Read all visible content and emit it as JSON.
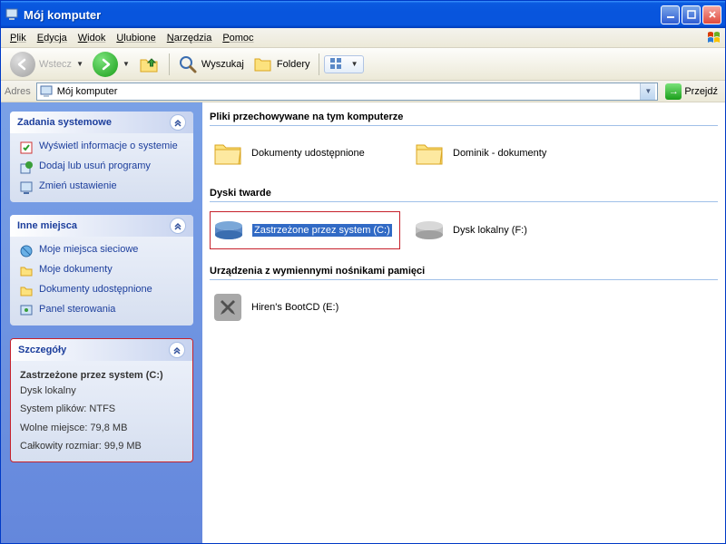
{
  "titlebar": {
    "title": "Mój komputer"
  },
  "menubar": {
    "items": [
      "Plik",
      "Edycja",
      "Widok",
      "Ulubione",
      "Narzędzia",
      "Pomoc"
    ]
  },
  "toolbar": {
    "back": "Wstecz",
    "search": "Wyszukaj",
    "folders": "Foldery"
  },
  "addressbar": {
    "label": "Adres",
    "value": "Mój komputer",
    "go": "Przejdź"
  },
  "sidebar": {
    "tasks": {
      "title": "Zadania systemowe",
      "items": [
        "Wyświetl informacje o systemie",
        "Dodaj lub usuń programy",
        "Zmień ustawienie"
      ]
    },
    "places": {
      "title": "Inne miejsca",
      "items": [
        "Moje miejsca sieciowe",
        "Moje dokumenty",
        "Dokumenty udostępnione",
        "Panel sterowania"
      ]
    },
    "details": {
      "title": "Szczegóły",
      "name": "Zastrzeżone przez system (C:)",
      "type": "Dysk lokalny",
      "fs": "System plików: NTFS",
      "free": "Wolne miejsce: 79,8 MB",
      "total": "Całkowity rozmiar: 99,9 MB"
    }
  },
  "main": {
    "group1": "Pliki przechowywane na tym komputerze",
    "group1_items": [
      "Dokumenty udostępnione",
      "Dominik - dokumenty"
    ],
    "group2": "Dyski twarde",
    "group2_items": [
      "Zastrzeżone przez system (C:)",
      "Dysk lokalny (F:)"
    ],
    "group3": "Urządzenia z wymiennymi nośnikami pamięci",
    "group3_items": [
      "Hiren's BootCD (E:)"
    ]
  }
}
